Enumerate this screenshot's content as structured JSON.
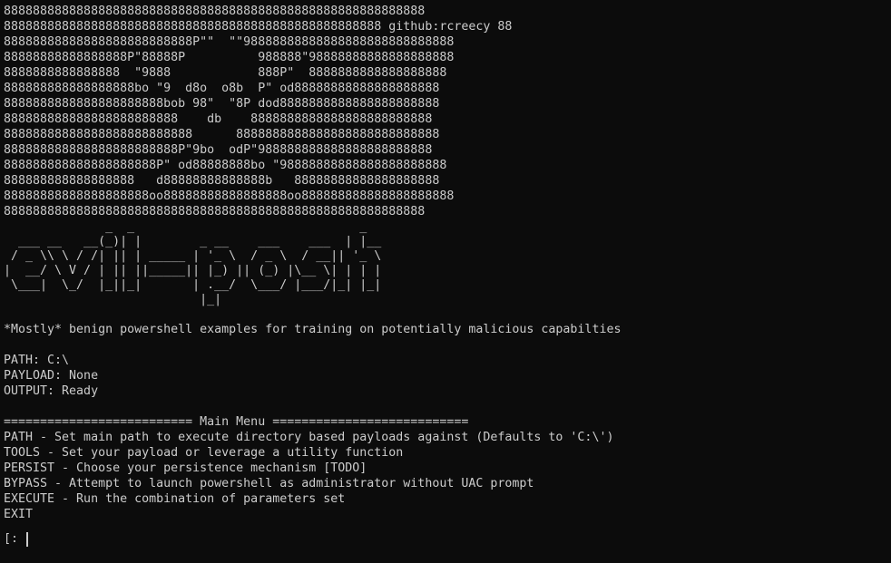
{
  "banner": [
    "8888888888888888888888888888888888888888888888888888888888",
    "8888888888888888888888888888888888888888888888888888 github:rcreecy 88",
    "88888888888888888888888888P\"\"  \"\"98888888888888888888888888888",
    "88888888888888888P\"88888P          988888\"98888888888888888888",
    "8888888888888888  \"9888            888P\"  8888888888888888888",
    "888888888888888888bo \"9  d8o  o8b  P\" od88888888888888888888",
    "8888888888888888888888bob 98\"  \"8P dod8888888888888888888888",
    "888888888888888888888888    db    8888888888888888888888888",
    "88888888888888888888888888      8888888888888888888888888888",
    "888888888888888888888888P\"9bo  odP\"988888888888888888888888",
    "888888888888888888888P\" od88888888bo \"98888888888888888888888",
    "888888888888888888   d88888888888888b   88888888888888888888",
    "88888888888888888888oo88888888888888888oo888888888888888888888",
    "8888888888888888888888888888888888888888888888888888888888"
  ],
  "logo_art": [
    "              _  _                               _",
    "  ___ __   __(_)| |        _ __    ___    ___  | |__",
    " / _ \\\\ \\ / /| || | _____ | '_ \\  / _ \\  / __|| '_ \\",
    "|  __/ \\ V / | || ||_____|| |_) || (_) |\\__ \\| | | |",
    " \\___|  \\_/  |_||_|       | .__/  \\___/ |___/|_| |_|",
    "                           |_|"
  ],
  "tagline": "*Mostly* benign powershell examples for training on potentially malicious capabilties",
  "status": {
    "path": "PATH: C:\\",
    "payload": "PAYLOAD: None",
    "output": "OUTPUT: Ready"
  },
  "menu": {
    "header": "========================== Main Menu ===========================",
    "items": [
      "PATH - Set main path to execute directory based payloads against (Defaults to 'C:\\')",
      "TOOLS - Set your payload or leverage a utility function",
      "PERSIST - Choose your persistence mechanism [TODO]",
      "BYPASS - Attempt to launch powershell as administrator without UAC prompt",
      "EXECUTE - Run the combination of parameters set",
      "EXIT"
    ]
  },
  "prompt": {
    "text": "[: ",
    "input_value": ""
  }
}
